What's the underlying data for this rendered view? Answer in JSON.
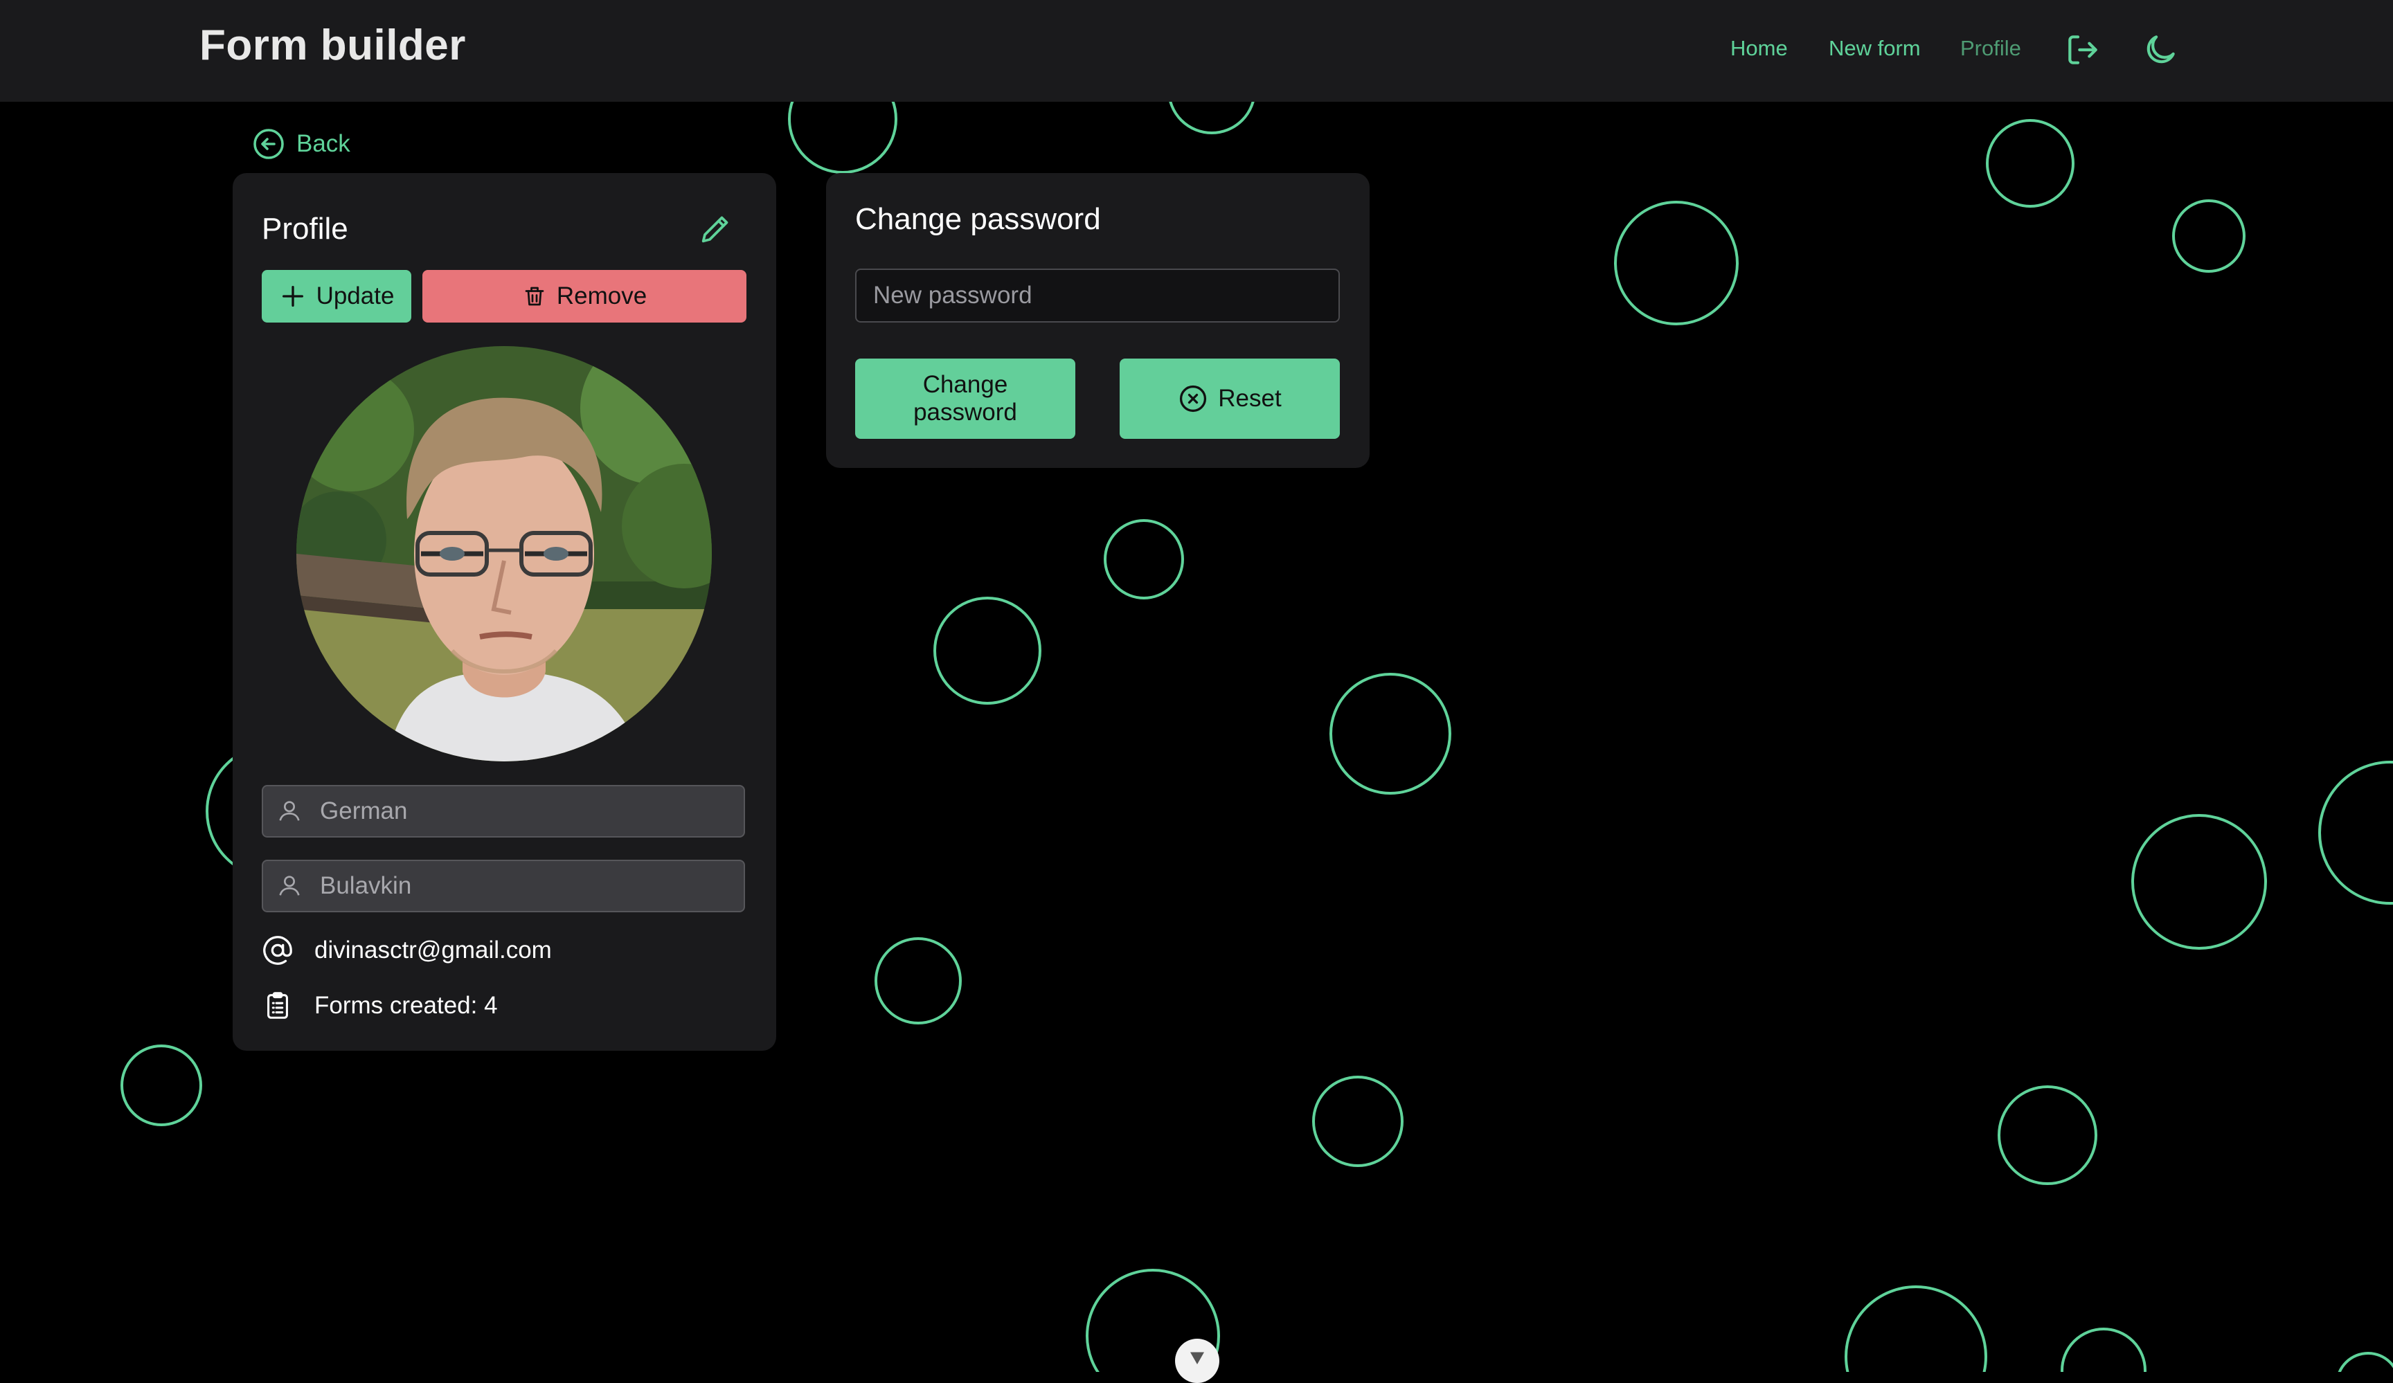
{
  "header": {
    "brand": "Form builder",
    "nav": {
      "home": "Home",
      "new_form": "New form",
      "profile": "Profile"
    },
    "icons": {
      "logout": "logout-icon",
      "theme": "moon-icon"
    }
  },
  "back": {
    "label": "Back",
    "icon": "arrow-left-circle-icon"
  },
  "profile": {
    "title": "Profile",
    "edit_icon": "pencil-icon",
    "update_label": "Update",
    "remove_label": "Remove",
    "first_name": "German",
    "last_name": "Bulavkin",
    "email": "divinasctr@gmail.com",
    "forms_created": "Forms created: 4"
  },
  "change_password": {
    "title": "Change password",
    "input_placeholder": "New password",
    "submit_label": "Change password",
    "reset_label": "Reset"
  },
  "colors": {
    "accent": "#63cf9a",
    "danger": "#e8757a",
    "card_bg": "#1a1a1c",
    "page_bg": "#000000",
    "bubble_stroke": "#5fd39a"
  }
}
